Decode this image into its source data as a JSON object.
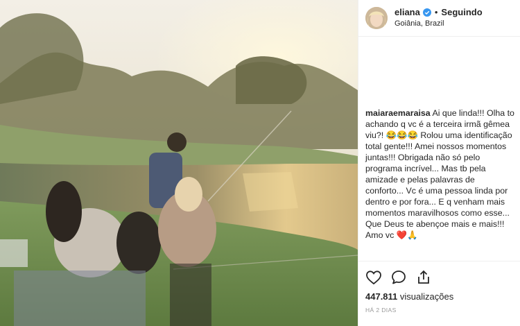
{
  "header": {
    "username": "eliana",
    "separator": "•",
    "follow_status": "Seguindo",
    "location": "Goiânia, Brazil"
  },
  "comment": {
    "username": "maiaraemaraisa",
    "text": "Ai que linda!!! Olha to achando q vc é a terceira irmã gêmea viu?! 😂😂😂 Rolou uma identificação total gente!!! Amei nossos momentos juntas!!! Obrigada não só pelo programa incrível... Mas tb pela amizade e pelas palavras de conforto... Vc é uma pessoa linda por dentro e por fora... E q venham mais momentos maravilhosos como esse... Que Deus te abençoe mais e mais!!! Amo vc",
    "emoji_tail_1": "❤️",
    "emoji_tail_2": "🙏"
  },
  "actions": {
    "like_icon": "heart-outline-icon",
    "comment_icon": "comment-bubble-icon",
    "share_icon": "share-arrow-icon"
  },
  "stats": {
    "views_count": "447.811",
    "views_label": "visualizações",
    "posted_ago": "HÁ 2 DIAS"
  },
  "colors": {
    "verified_badge": "#3897f0",
    "heart_emoji": "#ed4956",
    "text": "#262626",
    "muted": "#999999"
  }
}
